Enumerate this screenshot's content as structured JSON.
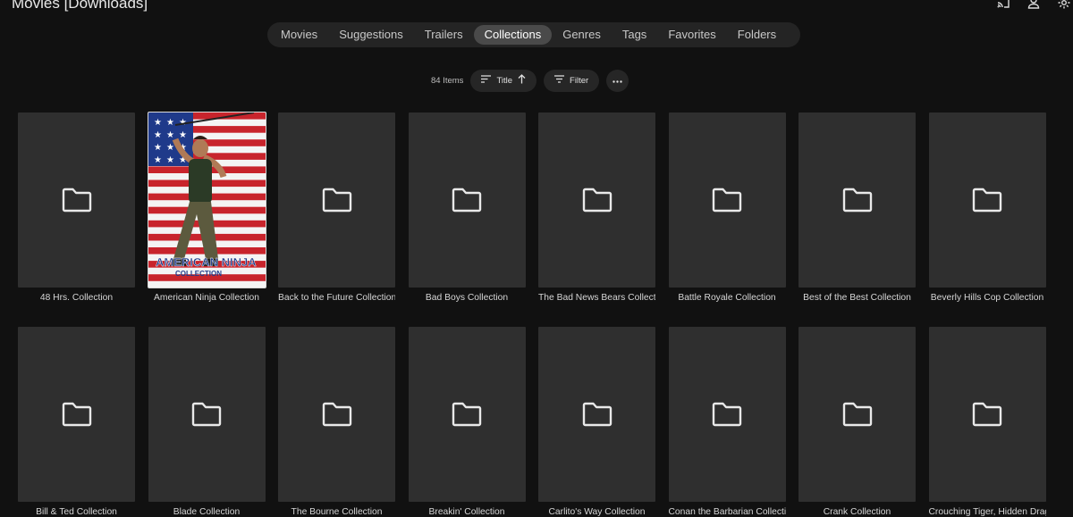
{
  "page": {
    "title": "Movies [Downloads]"
  },
  "header": {
    "icons": [
      "cast-icon",
      "user-icon",
      "settings-icon"
    ]
  },
  "tabs": [
    {
      "label": "Movies",
      "active": false
    },
    {
      "label": "Suggestions",
      "active": false
    },
    {
      "label": "Trailers",
      "active": false
    },
    {
      "label": "Collections",
      "active": true
    },
    {
      "label": "Genres",
      "active": false
    },
    {
      "label": "Tags",
      "active": false
    },
    {
      "label": "Favorites",
      "active": false
    },
    {
      "label": "Folders",
      "active": false
    }
  ],
  "toolbar": {
    "item_count": "84 Items",
    "sort_label": "Title",
    "filter_label": "Filter"
  },
  "items": [
    {
      "title": "48 Hrs. Collection",
      "image": false
    },
    {
      "title": "American Ninja Collection",
      "image": true
    },
    {
      "title": "Back to the Future Collection",
      "image": false
    },
    {
      "title": "Bad Boys Collection",
      "image": false
    },
    {
      "title": "The Bad News Bears Collection",
      "image": false
    },
    {
      "title": "Battle Royale Collection",
      "image": false
    },
    {
      "title": "Best of the Best Collection",
      "image": false
    },
    {
      "title": "Beverly Hills Cop Collection",
      "image": false
    },
    {
      "title": "Bill & Ted Collection",
      "image": false
    },
    {
      "title": "Blade Collection",
      "image": false
    },
    {
      "title": "The Bourne Collection",
      "image": false
    },
    {
      "title": "Breakin' Collection",
      "image": false
    },
    {
      "title": "Carlito's Way Collection",
      "image": false
    },
    {
      "title": "Conan the Barbarian Collection",
      "image": false
    },
    {
      "title": "Crank Collection",
      "image": false
    },
    {
      "title": "Crouching Tiger, Hidden Dragon Collection",
      "image": false
    }
  ],
  "poster_art": {
    "logo_text": "AMERICAN NINJA",
    "logo_sub": "COLLECTION"
  },
  "colors": {
    "background": "#111111",
    "card": "#2f2f2f",
    "active_tab": "#4a4a4a"
  }
}
